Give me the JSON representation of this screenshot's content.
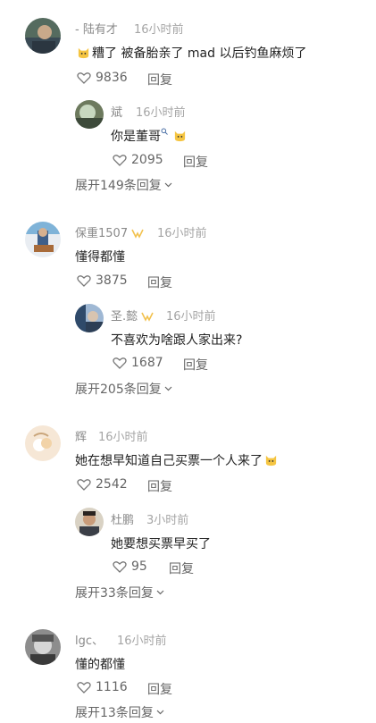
{
  "comments": [
    {
      "user": "- 陆有才",
      "time": "16小时前",
      "text_main": "糟了 被备胎亲了 mad 以后钓鱼麻烦了",
      "likes": "9836",
      "reply_label": "回复",
      "sub": {
        "user": "斌",
        "time": "16小时前",
        "text": "你是董哥",
        "likes": "2095",
        "reply_label": "回复"
      },
      "expand": "展开149条回复"
    },
    {
      "user": "保重1507",
      "time": "16小时前",
      "text_main": "懂得都懂",
      "likes": "3875",
      "reply_label": "回复",
      "sub": {
        "user": "圣.懿",
        "time": "16小时前",
        "text": "不喜欢为啥跟人家出来?",
        "likes": "1687",
        "reply_label": "回复"
      },
      "expand": "展开205条回复"
    },
    {
      "user": "辉",
      "time": "16小时前",
      "text_main": "她在想早知道自己买票一个人来了",
      "likes": "2542",
      "reply_label": "回复",
      "sub": {
        "user": "杜鹏",
        "time": "3小时前",
        "text": "她要想买票早买了",
        "likes": "95",
        "reply_label": "回复"
      },
      "expand": "展开33条回复"
    },
    {
      "user": "lgc、",
      "time": "16小时前",
      "text_main": "懂的都懂",
      "likes": "1116",
      "reply_label": "回复",
      "expand": "展开13条回复"
    }
  ],
  "colors": {
    "badge": "#f2c14e",
    "emoji": "#f5c542"
  }
}
